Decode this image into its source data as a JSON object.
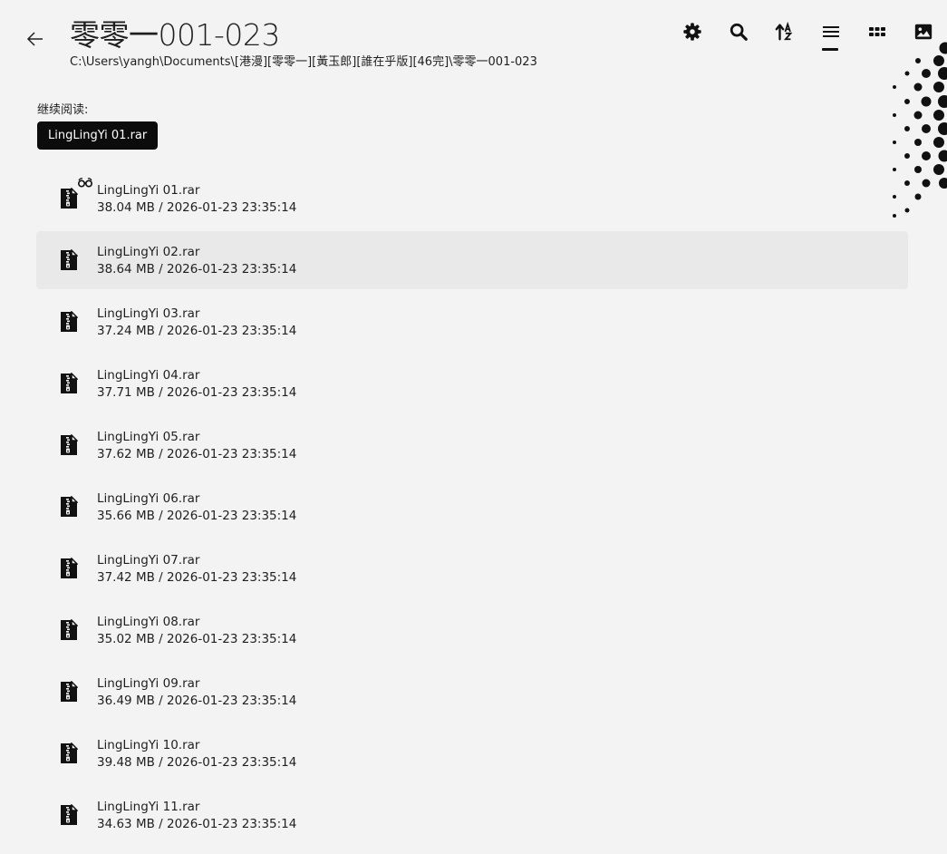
{
  "header": {
    "title": "零零一001-023",
    "path": "C:\\Users\\yangh\\Documents\\[港漫][零零一][黃玉郎][誰在乎版][46完]\\零零一001-023"
  },
  "toolbar": {
    "icons": [
      "gear-icon",
      "search-icon",
      "sort-az-icon",
      "list-view-icon",
      "grid-view-icon",
      "image-view-icon"
    ],
    "active": "list-view-icon"
  },
  "continue_reading": {
    "label": "继续阅读:",
    "button": "LingLingYi 01.rar"
  },
  "files": [
    {
      "name": "LingLingYi 01.rar",
      "meta": "38.04 MB / 2026-01-23 23:35:14",
      "reading": true
    },
    {
      "name": "LingLingYi 02.rar",
      "meta": "38.64 MB / 2026-01-23 23:35:14",
      "hover": true
    },
    {
      "name": "LingLingYi 03.rar",
      "meta": "37.24 MB / 2026-01-23 23:35:14"
    },
    {
      "name": "LingLingYi 04.rar",
      "meta": "37.71 MB / 2026-01-23 23:35:14"
    },
    {
      "name": "LingLingYi 05.rar",
      "meta": "37.62 MB / 2026-01-23 23:35:14"
    },
    {
      "name": "LingLingYi 06.rar",
      "meta": "35.66 MB / 2026-01-23 23:35:14"
    },
    {
      "name": "LingLingYi 07.rar",
      "meta": "37.42 MB / 2026-01-23 23:35:14"
    },
    {
      "name": "LingLingYi 08.rar",
      "meta": "35.02 MB / 2026-01-23 23:35:14"
    },
    {
      "name": "LingLingYi 09.rar",
      "meta": "36.49 MB / 2026-01-23 23:35:14"
    },
    {
      "name": "LingLingYi 10.rar",
      "meta": "39.48 MB / 2026-01-23 23:35:14"
    },
    {
      "name": "LingLingYi 11.rar",
      "meta": "34.63 MB / 2026-01-23 23:35:14"
    }
  ]
}
